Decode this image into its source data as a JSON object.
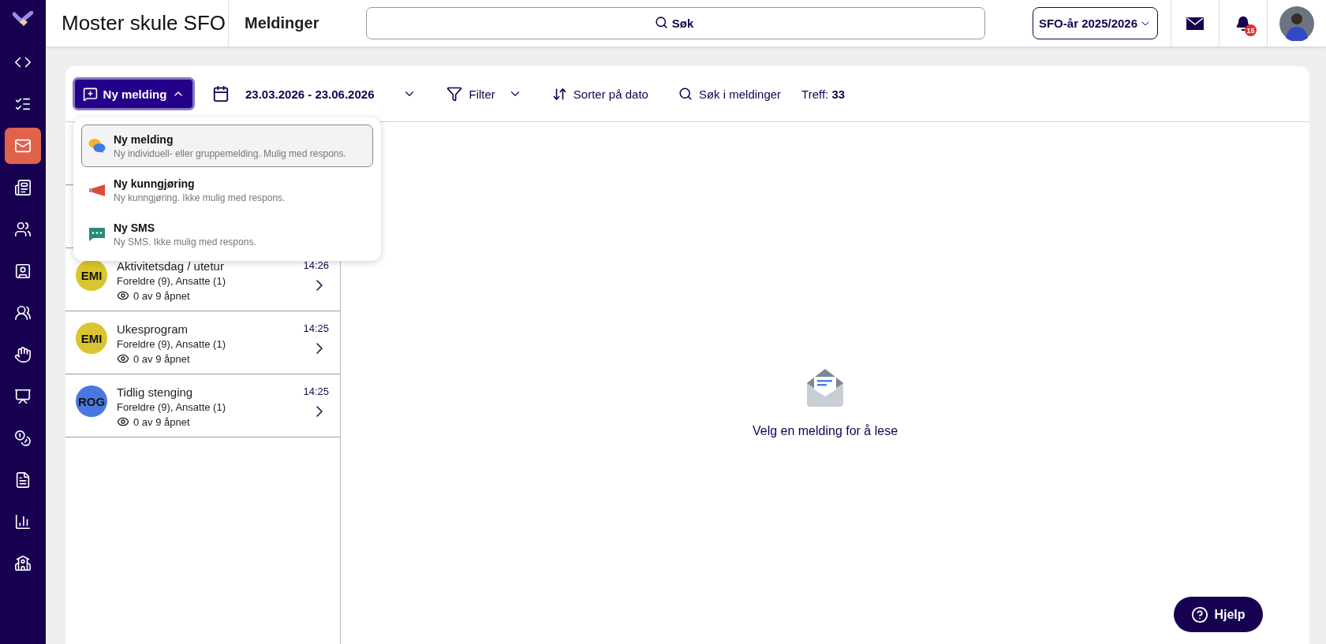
{
  "header": {
    "school": "Moster skule SFO",
    "page": "Meldinger",
    "search": {
      "placeholder": "Søk"
    },
    "year": "SFO-år 2025/2026",
    "notifications": "15"
  },
  "sidebar": {
    "items": [
      {
        "selected": false
      },
      {
        "selected": false
      },
      {
        "selected": true
      },
      {
        "selected": false
      },
      {
        "selected": false
      },
      {
        "selected": false
      },
      {
        "selected": false
      },
      {
        "selected": false
      },
      {
        "selected": false
      },
      {
        "selected": false
      },
      {
        "selected": false
      },
      {
        "selected": false
      },
      {
        "selected": false
      }
    ]
  },
  "toolbar": {
    "new_button": {
      "label": "Ny melding",
      "expanded": true
    },
    "date_range": "23.03.2026 - 23.06.2026",
    "filter": "Filter",
    "sort": "Sorter på dato",
    "search": "Søk i meldinger",
    "hits": "Treff: **33**"
  },
  "menu": [
    {
      "title": "Ny melding",
      "description": "Ny individuell- eller gruppemelding. Mulig med respons.",
      "selected": true
    },
    {
      "title": "Ny kunngjøring",
      "description": "Ny kunngjøring. Ikke mulig med respons.",
      "selected": false
    },
    {
      "title": "Ny SMS",
      "description": "Ny SMS. Ikke mulig med respons.",
      "selected": false
    }
  ],
  "messages": [
    {
      "initials": "EMI",
      "color": "#d9c52f",
      "title": "Aktivitetsdag / utetur",
      "recipients": "Foreldre (9), Ansatte (1)",
      "opened": "0 av 9 åpnet",
      "time": "14:26"
    },
    {
      "initials": "EMI",
      "color": "#d9c52f",
      "title": "Ukesprogram",
      "recipients": "Foreldre (9), Ansatte (1)",
      "opened": "0 av 9 åpnet",
      "time": "14:25"
    },
    {
      "initials": "ROG",
      "color": "#4a78e0",
      "title": "Tidlig stenging",
      "recipients": "Foreldre (9), Ansatte (1)",
      "opened": "0 av 9 åpnet",
      "time": "14:25"
    }
  ],
  "empty_state": "Velg en melding for å lese",
  "help": "Hjelp"
}
